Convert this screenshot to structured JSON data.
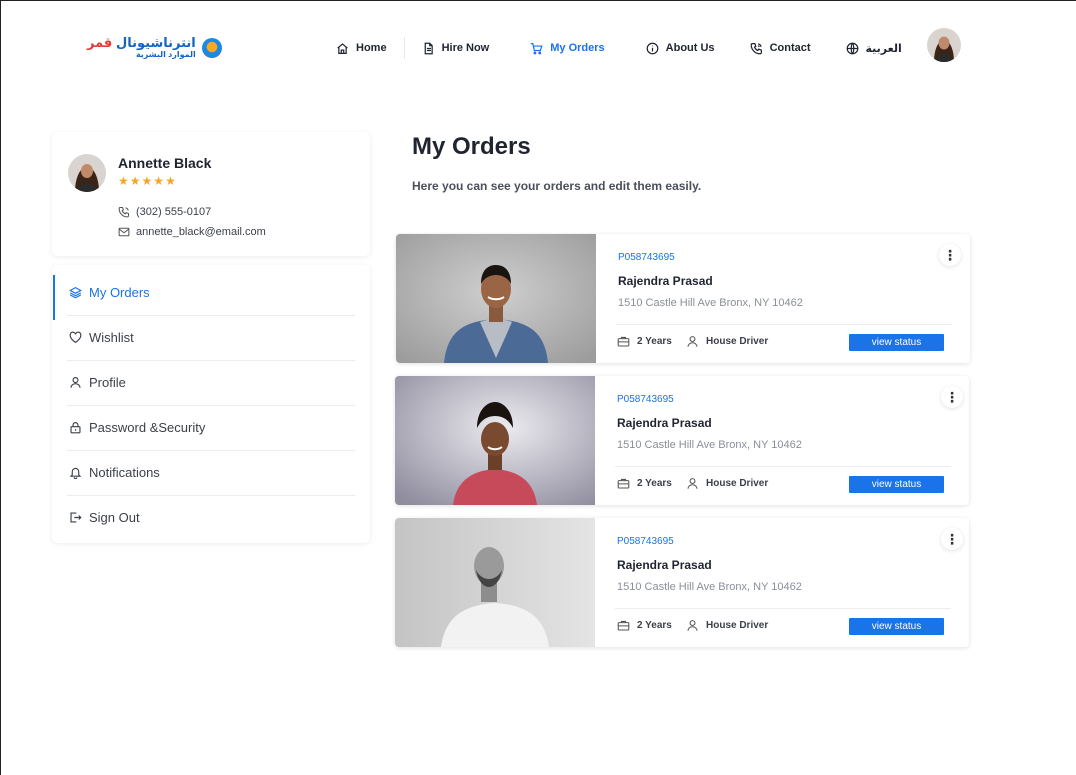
{
  "logo": {
    "name_part1": "قمر",
    "name_part2": "انترناشيونال",
    "tagline": "الموارد البشرية"
  },
  "nav": {
    "items": [
      {
        "label": "Home",
        "icon": "home-icon"
      },
      {
        "label": "Hire Now",
        "icon": "document-icon"
      },
      {
        "label": "My Orders",
        "icon": "cart-icon",
        "active": true
      },
      {
        "label": "About Us",
        "icon": "info-icon"
      },
      {
        "label": "Contact",
        "icon": "phone-icon"
      },
      {
        "label": "العربية",
        "icon": "globe-icon"
      }
    ]
  },
  "profile": {
    "name": "Annette Black",
    "rating": 5,
    "phone": "(302) 555-0107",
    "email": "annette_black@email.com"
  },
  "sidebar": {
    "items": [
      {
        "label": "My Orders",
        "icon": "layers-icon",
        "active": true
      },
      {
        "label": "Wishlist",
        "icon": "heart-icon"
      },
      {
        "label": "Profile",
        "icon": "user-icon"
      },
      {
        "label": "Password &Security",
        "icon": "lock-icon"
      },
      {
        "label": "Notifications",
        "icon": "bell-icon"
      },
      {
        "label": "Sign Out",
        "icon": "sign-out-icon"
      }
    ]
  },
  "main": {
    "title": "My Orders",
    "subtitle": "Here you can see your orders and edit them easily."
  },
  "orders": [
    {
      "id": "P058743695",
      "name": "Rajendra Prasad",
      "address": "1510 Castle Hill Ave Bronx, NY 10462",
      "experience": "2 Years",
      "role": "House Driver",
      "action": "view status",
      "menu": "⋮"
    },
    {
      "id": "P058743695",
      "name": "Rajendra Prasad",
      "address": "1510 Castle Hill Ave Bronx, NY 10462",
      "experience": "2 Years",
      "role": "House Driver",
      "action": "view status",
      "menu": "⋮"
    },
    {
      "id": "P058743695",
      "name": "Rajendra Prasad",
      "address": "1510 Castle Hill Ave Bronx, NY 10462",
      "experience": "2 Years",
      "role": "House Driver",
      "action": "view status",
      "menu": "⋮"
    }
  ],
  "colors": {
    "accent": "#1a73e8",
    "star": "#f5a623",
    "text": "#1f2430"
  }
}
